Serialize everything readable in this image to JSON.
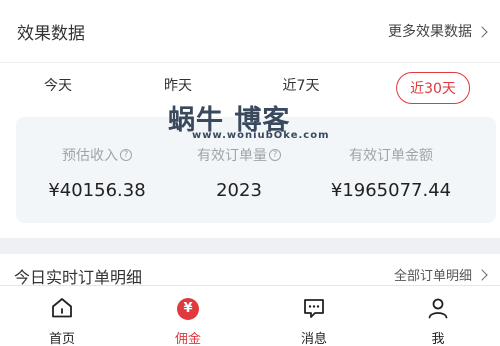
{
  "header": {
    "title": "效果数据",
    "more_label": "更多效果数据"
  },
  "tabs": [
    {
      "label": "今天",
      "active": false
    },
    {
      "label": "昨天",
      "active": false
    },
    {
      "label": "近7天",
      "active": false
    },
    {
      "label": "近30天",
      "active": true
    }
  ],
  "metrics": [
    {
      "label": "预估收入",
      "value": "¥40156.38",
      "has_help": true
    },
    {
      "label": "有效订单量",
      "value": "2023",
      "has_help": true
    },
    {
      "label": "有效订单金额",
      "value": "¥1965077.44",
      "has_help": false
    }
  ],
  "help_glyph": "?",
  "watermark": {
    "main": "蜗牛 博客",
    "sub": "www.woniubOke.com"
  },
  "realtime": {
    "title": "今日实时订单明细",
    "more_label": "全部订单明细"
  },
  "nav": {
    "items": [
      {
        "label": "首页",
        "icon": "home-icon",
        "active": false
      },
      {
        "label": "佣金",
        "icon": "yen-icon",
        "active": true
      },
      {
        "label": "消息",
        "icon": "message-icon",
        "active": false
      },
      {
        "label": "我",
        "icon": "user-icon",
        "active": false
      }
    ],
    "yen_glyph": "¥"
  },
  "colors": {
    "accent": "#e0393e",
    "card_bg": "#f3f6f9",
    "muted_text": "#a0a4aa"
  }
}
